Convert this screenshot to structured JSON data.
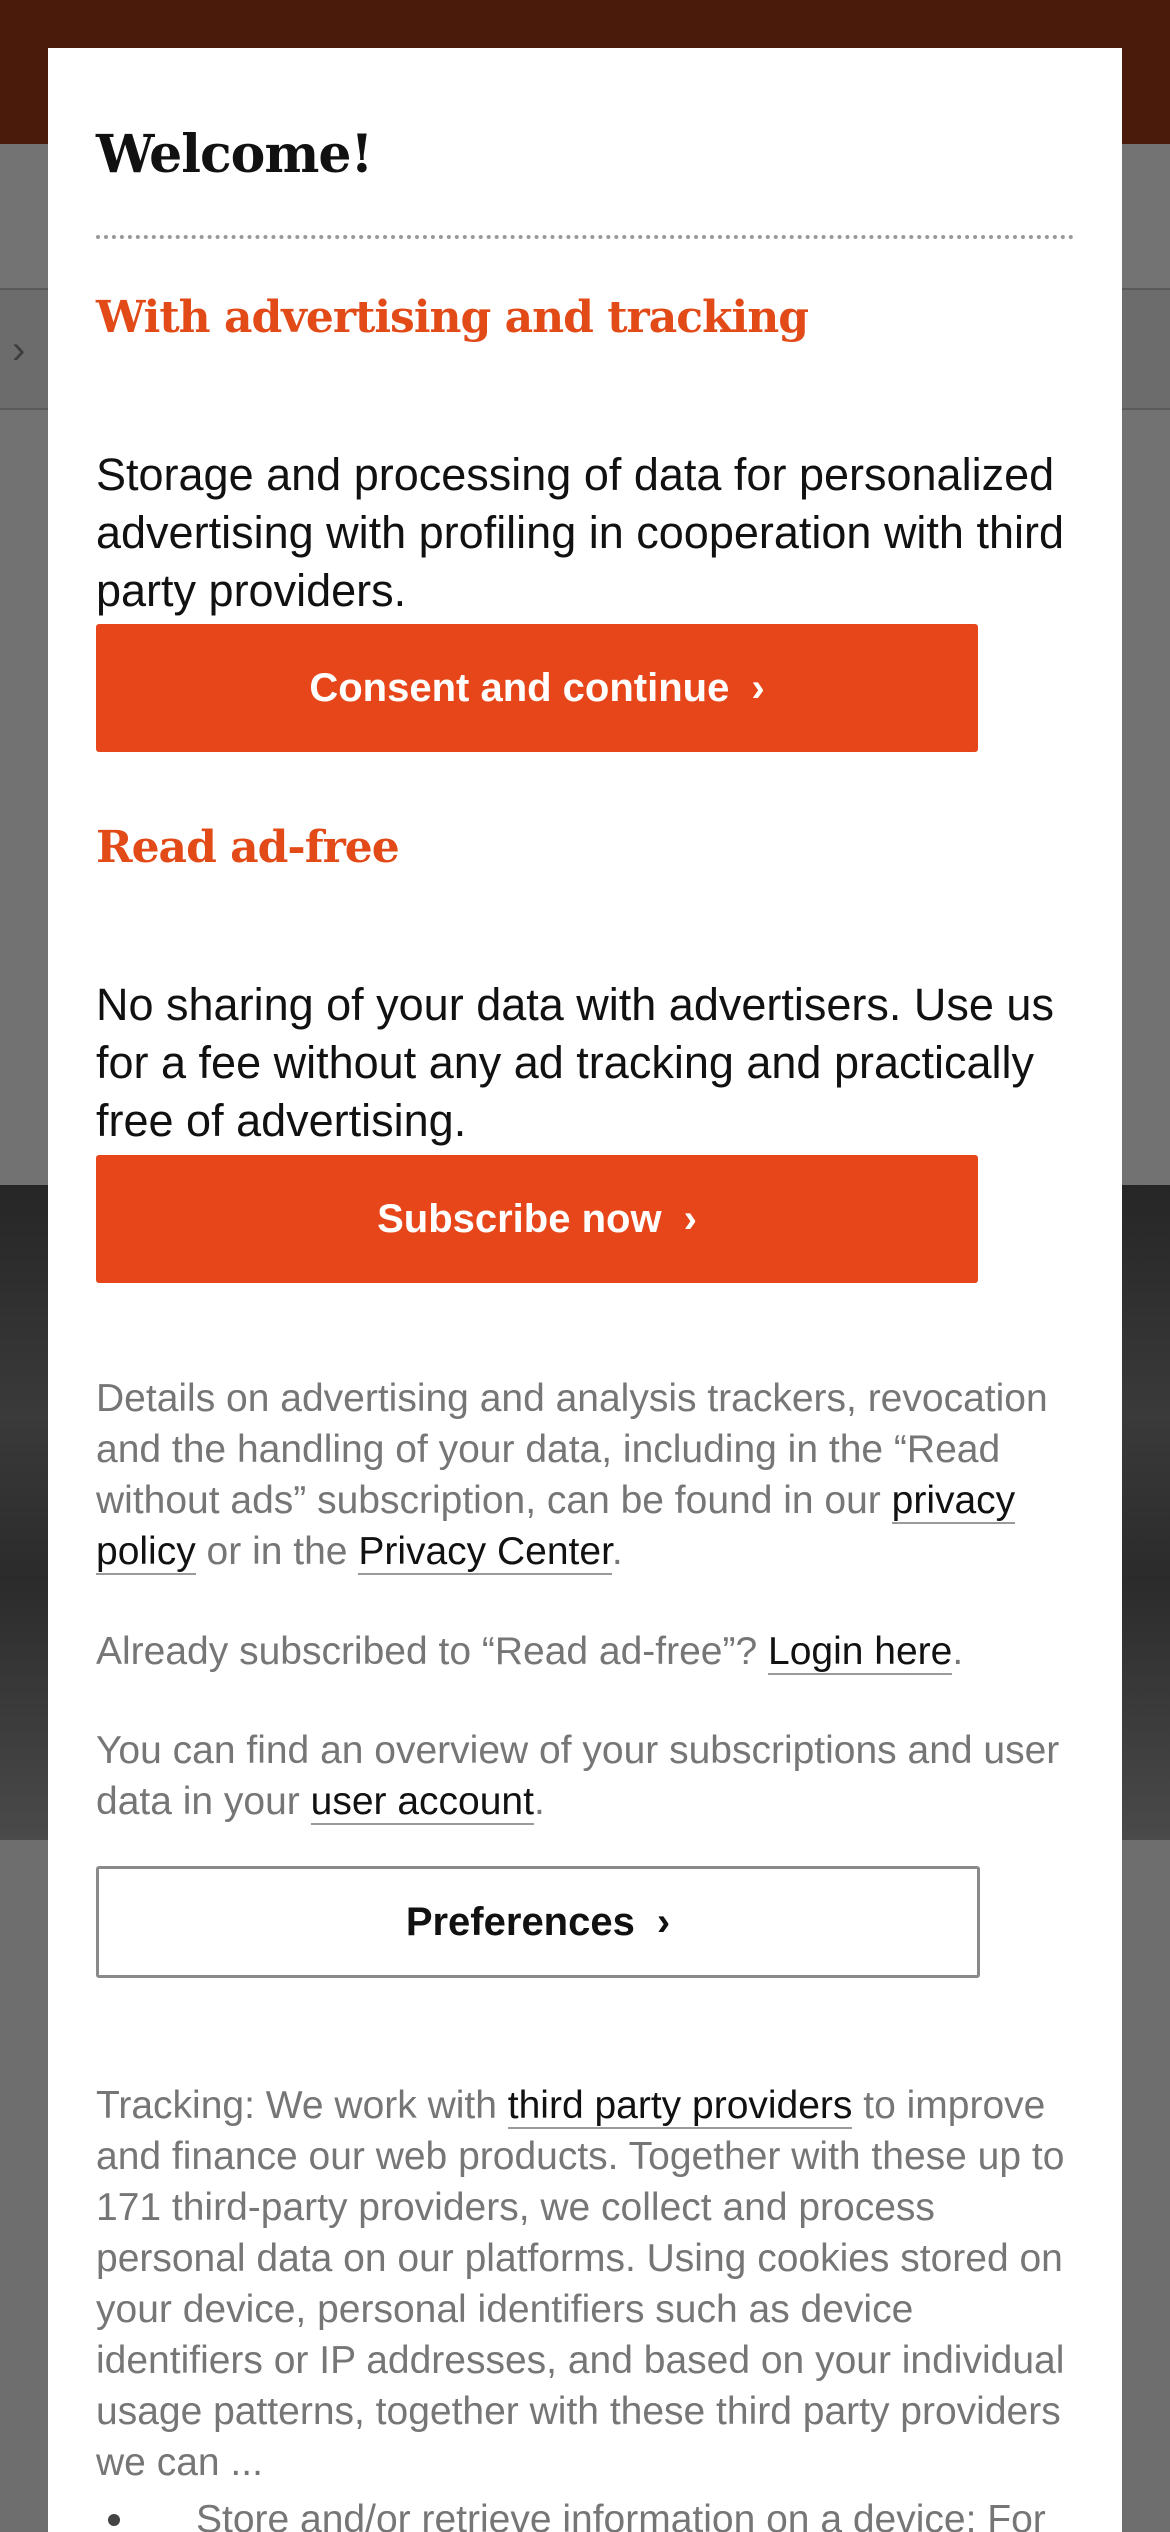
{
  "dialog": {
    "title": "Welcome!",
    "ads_section": {
      "heading": "With advertising and tracking",
      "description": "Storage and processing of data for personalized advertising with profiling in cooperation with third party providers.",
      "button_label": "Consent and continue"
    },
    "adfree_section": {
      "heading": "Read ad-free",
      "description": "No sharing of your data with advertisers. Use us for a fee without any ad tracking and practically free of advertising.",
      "button_label": "Subscribe now"
    },
    "details": {
      "text_before": "Details on advertising and analysis trackers, revocation and the handling of your data, including in the “Read without ads” subscription, can be found in our ",
      "privacy_policy_link": "privacy policy",
      "text_middle": " or in the ",
      "privacy_center_link": "Privacy Center",
      "text_after": "."
    },
    "login": {
      "text_before": "Already subscribed to “Read ad-free”? ",
      "link": "Login here",
      "text_after": "."
    },
    "account": {
      "text_before": "You can find an overview of your subscriptions and user data in your ",
      "link": "user account",
      "text_after": "."
    },
    "preferences_button": "Preferences",
    "tracking": {
      "text_before": "Tracking: We work with ",
      "link": "third party providers",
      "text_after": " to improve and finance our web products. Together with these up to 171 third-party providers, we collect and process personal data on our platforms. Using cookies stored on your device, personal identifiers such as device identifiers or IP addresses, and based on your individual usage patterns, together with these third party providers we can ..."
    },
    "bullet_first": "Store and/or retrieve information on a device: For"
  },
  "icons": {
    "chevron": "chevron-right-icon",
    "bullet": "bullet-icon"
  },
  "colors": {
    "accent": "#e64619",
    "heading_accent": "#e24a18",
    "muted_text": "#767676"
  }
}
